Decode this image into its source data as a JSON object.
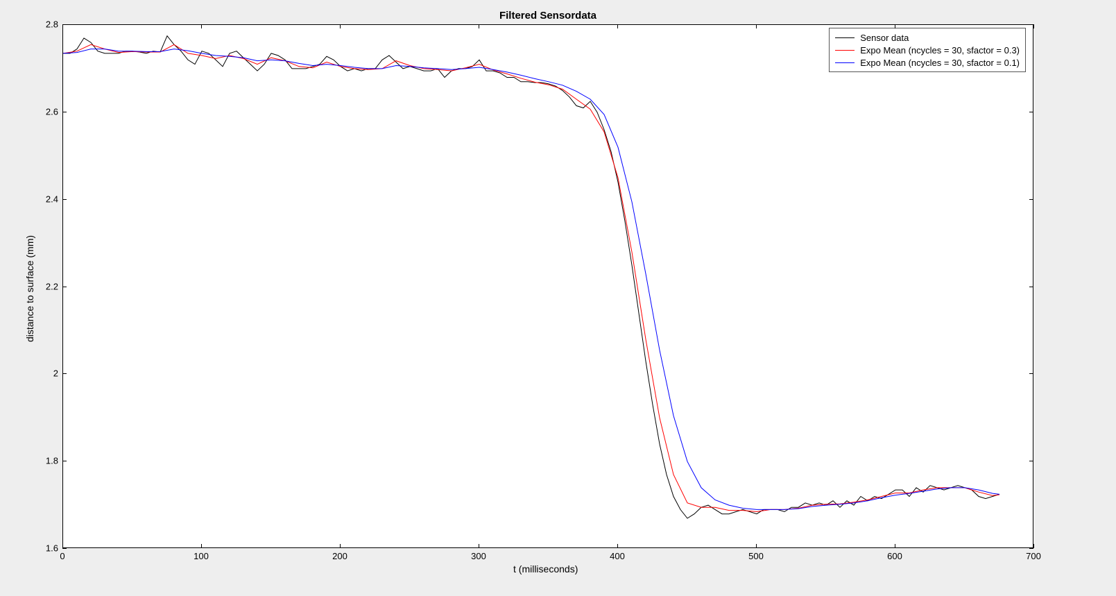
{
  "chart_data": {
    "type": "line",
    "title": "Filtered Sensordata",
    "xlabel": "t (milliseconds)",
    "ylabel": "distance to surface (mm)",
    "xlim": [
      0,
      700
    ],
    "ylim": [
      1.6,
      2.8
    ],
    "xticks": [
      0,
      100,
      200,
      300,
      400,
      500,
      600,
      700
    ],
    "yticks": [
      1.6,
      1.8,
      2.0,
      2.2,
      2.4,
      2.6,
      2.8
    ],
    "legend_position": "northeast",
    "series": [
      {
        "name": "Sensor data",
        "color": "#000000",
        "x": [
          0,
          5,
          10,
          15,
          20,
          25,
          30,
          35,
          40,
          45,
          50,
          55,
          60,
          65,
          70,
          75,
          80,
          85,
          90,
          95,
          100,
          105,
          110,
          115,
          120,
          125,
          130,
          135,
          140,
          145,
          150,
          155,
          160,
          165,
          170,
          175,
          180,
          185,
          190,
          195,
          200,
          205,
          210,
          215,
          220,
          225,
          230,
          235,
          240,
          245,
          250,
          255,
          260,
          265,
          270,
          275,
          280,
          285,
          290,
          295,
          300,
          305,
          310,
          315,
          320,
          325,
          330,
          335,
          340,
          345,
          350,
          355,
          360,
          365,
          370,
          375,
          380,
          385,
          390,
          395,
          400,
          405,
          410,
          415,
          420,
          425,
          430,
          435,
          440,
          445,
          450,
          455,
          460,
          465,
          470,
          475,
          480,
          485,
          490,
          495,
          500,
          505,
          510,
          515,
          520,
          525,
          530,
          535,
          540,
          545,
          550,
          555,
          560,
          565,
          570,
          575,
          580,
          585,
          590,
          595,
          600,
          605,
          610,
          615,
          620,
          625,
          630,
          635,
          640,
          645,
          650,
          655,
          660,
          665,
          670,
          675
        ],
        "y": [
          2.735,
          2.735,
          2.745,
          2.77,
          2.76,
          2.74,
          2.735,
          2.735,
          2.735,
          2.74,
          2.74,
          2.738,
          2.735,
          2.74,
          2.738,
          2.775,
          2.755,
          2.74,
          2.72,
          2.71,
          2.74,
          2.735,
          2.72,
          2.705,
          2.735,
          2.74,
          2.725,
          2.71,
          2.695,
          2.71,
          2.735,
          2.73,
          2.72,
          2.7,
          2.7,
          2.7,
          2.705,
          2.71,
          2.728,
          2.72,
          2.705,
          2.695,
          2.7,
          2.695,
          2.7,
          2.7,
          2.72,
          2.73,
          2.715,
          2.7,
          2.705,
          2.7,
          2.695,
          2.695,
          2.7,
          2.68,
          2.695,
          2.7,
          2.7,
          2.705,
          2.72,
          2.695,
          2.695,
          2.69,
          2.68,
          2.68,
          2.67,
          2.67,
          2.668,
          2.668,
          2.665,
          2.66,
          2.65,
          2.635,
          2.615,
          2.61,
          2.625,
          2.6,
          2.56,
          2.51,
          2.44,
          2.35,
          2.25,
          2.14,
          2.03,
          1.93,
          1.84,
          1.77,
          1.72,
          1.69,
          1.67,
          1.68,
          1.695,
          1.7,
          1.69,
          1.68,
          1.68,
          1.685,
          1.69,
          1.685,
          1.68,
          1.69,
          1.69,
          1.69,
          1.685,
          1.695,
          1.695,
          1.705,
          1.7,
          1.705,
          1.7,
          1.71,
          1.695,
          1.71,
          1.7,
          1.72,
          1.71,
          1.72,
          1.715,
          1.725,
          1.735,
          1.735,
          1.72,
          1.74,
          1.73,
          1.745,
          1.74,
          1.735,
          1.74,
          1.745,
          1.74,
          1.735,
          1.72,
          1.715,
          1.72,
          1.725
        ],
        "note": "approximate; local noise spikes present near x≈375 and minor oscillation x≈0-300"
      },
      {
        "name": "Expo Mean (ncycles = 30, sfactor = 0.3)",
        "color": "#ff0000",
        "x": [
          0,
          10,
          20,
          30,
          40,
          50,
          60,
          70,
          80,
          90,
          100,
          110,
          120,
          130,
          140,
          150,
          160,
          170,
          180,
          190,
          200,
          210,
          220,
          230,
          240,
          250,
          260,
          270,
          280,
          290,
          300,
          310,
          320,
          330,
          340,
          350,
          360,
          370,
          380,
          390,
          400,
          410,
          420,
          430,
          440,
          450,
          460,
          470,
          480,
          490,
          500,
          510,
          520,
          530,
          540,
          550,
          560,
          570,
          580,
          590,
          600,
          610,
          620,
          630,
          640,
          650,
          660,
          670,
          675
        ],
        "y": [
          2.735,
          2.74,
          2.755,
          2.745,
          2.737,
          2.739,
          2.738,
          2.738,
          2.755,
          2.735,
          2.73,
          2.723,
          2.73,
          2.723,
          2.71,
          2.725,
          2.718,
          2.705,
          2.702,
          2.715,
          2.705,
          2.7,
          2.698,
          2.7,
          2.718,
          2.707,
          2.7,
          2.698,
          2.695,
          2.702,
          2.71,
          2.697,
          2.688,
          2.678,
          2.669,
          2.663,
          2.653,
          2.63,
          2.607,
          2.555,
          2.45,
          2.28,
          2.08,
          1.9,
          1.77,
          1.705,
          1.695,
          1.695,
          1.688,
          1.688,
          1.685,
          1.69,
          1.69,
          1.693,
          1.7,
          1.702,
          1.703,
          1.707,
          1.712,
          1.72,
          1.728,
          1.728,
          1.735,
          1.74,
          1.74,
          1.74,
          1.73,
          1.722,
          1.724
        ],
        "note": "smoother, slight lag vs sensor"
      },
      {
        "name": "Expo Mean (ncycles = 30, sfactor = 0.1)",
        "color": "#0000ff",
        "x": [
          0,
          10,
          20,
          30,
          40,
          50,
          60,
          70,
          80,
          90,
          100,
          110,
          120,
          130,
          140,
          150,
          160,
          170,
          180,
          190,
          200,
          210,
          220,
          230,
          240,
          250,
          260,
          270,
          280,
          290,
          300,
          310,
          320,
          330,
          340,
          350,
          360,
          370,
          380,
          390,
          400,
          410,
          420,
          430,
          440,
          450,
          460,
          470,
          480,
          490,
          500,
          510,
          520,
          530,
          540,
          550,
          560,
          570,
          580,
          590,
          600,
          610,
          620,
          630,
          640,
          650,
          660,
          670,
          675
        ],
        "y": [
          2.735,
          2.737,
          2.745,
          2.745,
          2.74,
          2.74,
          2.739,
          2.739,
          2.745,
          2.741,
          2.735,
          2.73,
          2.728,
          2.725,
          2.718,
          2.72,
          2.718,
          2.712,
          2.707,
          2.71,
          2.707,
          2.703,
          2.7,
          2.7,
          2.707,
          2.705,
          2.702,
          2.7,
          2.698,
          2.7,
          2.703,
          2.698,
          2.692,
          2.685,
          2.677,
          2.67,
          2.662,
          2.648,
          2.63,
          2.595,
          2.52,
          2.395,
          2.23,
          2.055,
          1.905,
          1.8,
          1.74,
          1.712,
          1.7,
          1.693,
          1.69,
          1.69,
          1.69,
          1.692,
          1.697,
          1.7,
          1.702,
          1.705,
          1.71,
          1.717,
          1.723,
          1.727,
          1.732,
          1.737,
          1.74,
          1.74,
          1.735,
          1.727,
          1.725
        ],
        "note": "smoothest, most lag — right-shifted drop"
      }
    ]
  }
}
